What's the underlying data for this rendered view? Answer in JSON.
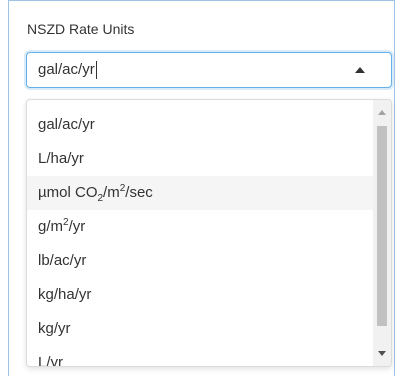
{
  "field": {
    "label": "NSZD Rate Units",
    "selected_value": "gal/ac/yr"
  },
  "dropdown": {
    "options": [
      {
        "text": "gal/ac/yr"
      },
      {
        "text": "L/ha/yr"
      },
      {
        "pre": "µmol CO",
        "sub": "2",
        "mid": "/m",
        "sup": "2",
        "post": "/sec"
      },
      {
        "pre": "g/m",
        "sup": "2",
        "post": "/yr"
      },
      {
        "text": "lb/ac/yr"
      },
      {
        "text": "kg/ha/yr"
      },
      {
        "text": "kg/yr"
      },
      {
        "text": "L/yr"
      }
    ],
    "hovered_index": 2
  },
  "icons": {
    "select_toggle": "chevron-up-icon",
    "scroll_up": "scroll-up-arrow-icon",
    "scroll_down": "scroll-down-arrow-icon"
  }
}
